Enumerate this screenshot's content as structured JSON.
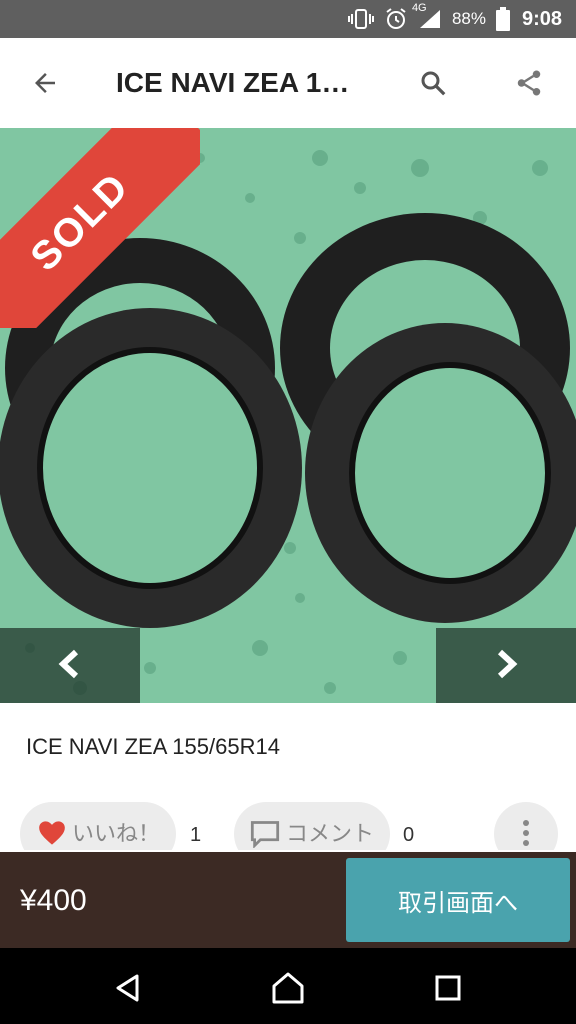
{
  "status_bar": {
    "network": "4G",
    "battery": "88%",
    "time": "9:08",
    "icons": [
      "vibrate-icon",
      "alarm-icon",
      "signal-icon",
      "battery-icon"
    ]
  },
  "app_bar": {
    "title": "ICE NAVI ZEA 1…",
    "back_icon": "arrow-back-icon",
    "search_icon": "search-icon",
    "share_icon": "share-icon"
  },
  "photo": {
    "badge": "SOLD",
    "prev_icon": "chevron-left-icon",
    "next_icon": "chevron-right-icon"
  },
  "item": {
    "title": "ICE NAVI ZEA 155/65R14"
  },
  "actions": {
    "like_label": "いいね！",
    "like_count": "1",
    "comment_label": "コメント",
    "comment_count": "0"
  },
  "purchase_bar": {
    "price": "¥400",
    "button_label": "取引画面へ"
  },
  "colors": {
    "status_bar": "#5f5f5f",
    "sold_ribbon": "#e0463a",
    "purchase_bar": "#3c2a24",
    "button": "#4aa3ad",
    "heart": "#e0463a"
  }
}
